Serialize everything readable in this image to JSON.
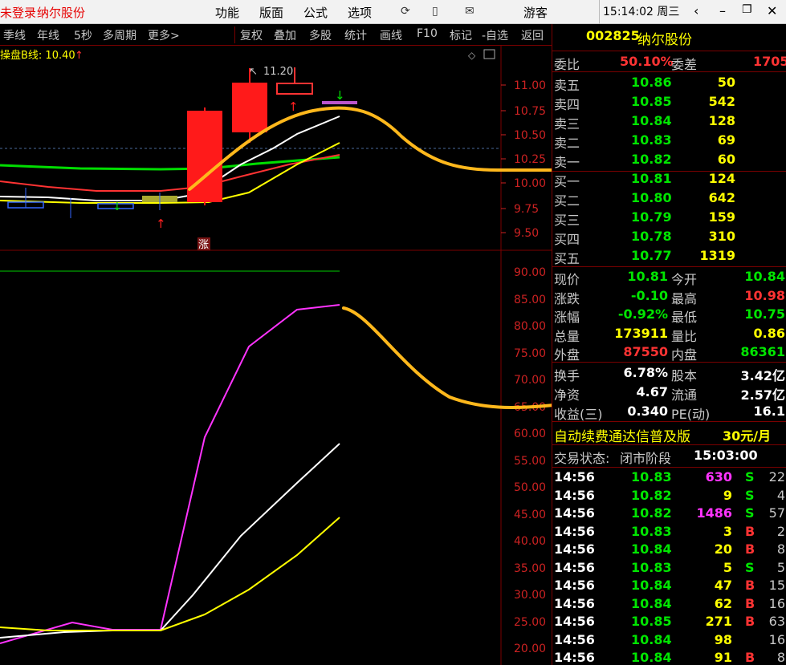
{
  "topbar": {
    "login": "未登录",
    "stock_name": "纳尔股份",
    "menu": [
      "功能",
      "版面",
      "公式",
      "选项"
    ],
    "guest": "游客",
    "time": "15:14:02",
    "weekday": "周三"
  },
  "toolbar": {
    "left": [
      "季线",
      "年线",
      "5秒",
      "多周期",
      "更多>"
    ],
    "right": [
      "复权",
      "叠加",
      "多股",
      "统计",
      "画线",
      "F10",
      "标记",
      "-自选",
      "返回"
    ]
  },
  "chart": {
    "indicator_label": "操盘B线: 10.40",
    "peak_label": "11.20",
    "zhang_label": "涨",
    "price_axis": [
      "11.00",
      "10.75",
      "10.50",
      "10.25",
      "10.00",
      "9.75",
      "9.50"
    ],
    "osc_axis": [
      "90.00",
      "85.00",
      "80.00",
      "75.00",
      "70.00",
      "65.00",
      "60.00",
      "55.00",
      "50.00",
      "45.00",
      "40.00",
      "35.00",
      "30.00",
      "25.00",
      "20.00"
    ]
  },
  "quote": {
    "code": "002825",
    "name": "纳尔股份",
    "weibi_label": "委比",
    "weibi": "50.10%",
    "weicha_label": "委差",
    "weicha": "1705",
    "asks": [
      {
        "label": "卖五",
        "price": "10.86",
        "vol": "50"
      },
      {
        "label": "卖四",
        "price": "10.85",
        "vol": "542"
      },
      {
        "label": "卖三",
        "price": "10.84",
        "vol": "128"
      },
      {
        "label": "卖二",
        "price": "10.83",
        "vol": "69"
      },
      {
        "label": "卖一",
        "price": "10.82",
        "vol": "60"
      }
    ],
    "bids": [
      {
        "label": "买一",
        "price": "10.81",
        "vol": "124"
      },
      {
        "label": "买二",
        "price": "10.80",
        "vol": "642"
      },
      {
        "label": "买三",
        "price": "10.79",
        "vol": "159"
      },
      {
        "label": "买四",
        "price": "10.78",
        "vol": "310"
      },
      {
        "label": "买五",
        "price": "10.77",
        "vol": "1319"
      }
    ],
    "stats": [
      {
        "l1": "现价",
        "v1": "10.81",
        "l2": "今开",
        "v2": "10.84"
      },
      {
        "l1": "涨跌",
        "v1": "-0.10",
        "l2": "最高",
        "v2": "10.98"
      },
      {
        "l1": "涨幅",
        "v1": "-0.92%",
        "l2": "最低",
        "v2": "10.75"
      },
      {
        "l1": "总量",
        "v1": "173911",
        "l2": "量比",
        "v2": "0.86"
      },
      {
        "l1": "外盘",
        "v1": "87550",
        "l2": "内盘",
        "v2": "86361"
      }
    ],
    "stats2": [
      {
        "l1": "换手",
        "v1": "6.78%",
        "l2": "股本",
        "v2": "3.42亿"
      },
      {
        "l1": "净资",
        "v1": "4.67",
        "l2": "流通",
        "v2": "2.57亿"
      },
      {
        "l1": "收益(三)",
        "v1": "0.340",
        "l2": "PE(动)",
        "v2": "16.1"
      }
    ],
    "promo": "自动续费通达信普及版",
    "promo_price": "30元/月",
    "status_label": "交易状态:",
    "status": "闭市阶段",
    "status_time": "15:03:00",
    "ticks": [
      {
        "t": "14:56",
        "p": "10.83",
        "v": "630",
        "bs": "S",
        "n": "22"
      },
      {
        "t": "14:56",
        "p": "10.82",
        "v": "9",
        "bs": "S",
        "n": "4"
      },
      {
        "t": "14:56",
        "p": "10.82",
        "v": "1486",
        "bs": "S",
        "n": "57"
      },
      {
        "t": "14:56",
        "p": "10.83",
        "v": "3",
        "bs": "B",
        "n": "2"
      },
      {
        "t": "14:56",
        "p": "10.84",
        "v": "20",
        "bs": "B",
        "n": "8"
      },
      {
        "t": "14:56",
        "p": "10.83",
        "v": "5",
        "bs": "S",
        "n": "5"
      },
      {
        "t": "14:56",
        "p": "10.84",
        "v": "47",
        "bs": "B",
        "n": "15"
      },
      {
        "t": "14:56",
        "p": "10.84",
        "v": "62",
        "bs": "B",
        "n": "16"
      },
      {
        "t": "14:56",
        "p": "10.85",
        "v": "271",
        "bs": "B",
        "n": "63"
      },
      {
        "t": "14:56",
        "p": "10.84",
        "v": "98",
        "bs": "",
        "n": "16"
      },
      {
        "t": "14:56",
        "p": "10.84",
        "v": "91",
        "bs": "B",
        "n": "8"
      }
    ]
  }
}
